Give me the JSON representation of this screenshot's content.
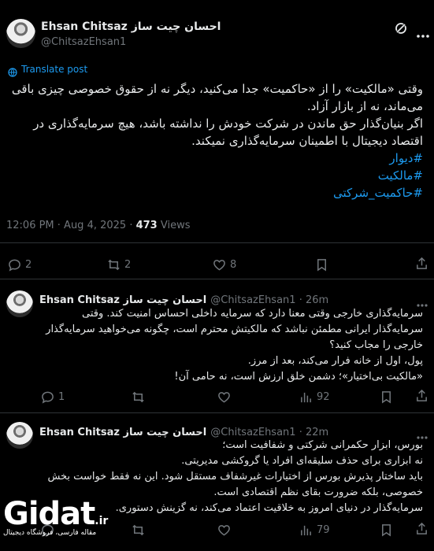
{
  "main_post": {
    "display_name": "Ehsan Chitsaz احسان چیت ساز",
    "handle": "@ChitsazEhsan1",
    "translate_label": "Translate post",
    "text_lines": [
      "وقتی «مالکیت» را از «حاکمیت» جدا می‌کنید، دیگر نه از حقوق خصوصی چیزی باقی",
      "می‌ماند، نه از بازار آزاد.",
      "اگر بنیان‌گذار حق ماندن در شرکت خودش را نداشته باشد، هیچ سرمایه‌گذاری در",
      "اقتصاد دیجیتال با اطمینان سرمایه‌گذاری نمیکند."
    ],
    "hashtags": [
      "#دیوار",
      "#مالکیت",
      "#حاکمیت_شرکتی"
    ],
    "time": "12:06 PM · Aug 4, 2025 · ",
    "views_count": "473",
    "views_label": " Views",
    "replies": "2",
    "reposts": "2",
    "likes": "8"
  },
  "replies": [
    {
      "display_name": "Ehsan Chitsaz احسان چیت ساز",
      "handle": "@ChitsazEhsan1 · 26m",
      "text_lines": [
        "سرمایه‌گذاری خارجی وقتی معنا دارد که سرمایه داخلی احساس امنیت کند. وقتی",
        "سرمایه‌گذار ایرانی مطمئن نباشد که مالکیتش محترم است، چگونه می‌خواهید سرمایه‌گذار",
        "خارجی را مجاب کنید؟",
        "پول، اول از خانه فرار می‌کند، بعد از مرز.",
        "«مالکیت بی‌اختیار»؛ دشمن خلق ارزش است، نه حامی آن!"
      ],
      "replies": "1",
      "views": "92"
    },
    {
      "display_name": "Ehsan Chitsaz احسان چیت ساز",
      "handle": "@ChitsazEhsan1 · 22m",
      "text_lines": [
        "بورس، ابزار حکمرانی شرکتی و شفافیت است؛",
        "نه ابزاری برای حذف سلیقه‌ای افراد یا گروکشی مدیریتی.",
        "باید ساختار پذیرش بورس از اختیارات غیرشفاف مستقل شود. این نه فقط خواست بخش",
        "خصوصی، بلکه ضرورت بقای نظم اقتصادی است.",
        "سرمایه‌گذار در دنیای امروز به خلاقیت اعتماد می‌کند، نه گزینش دستوری."
      ],
      "replies": "",
      "views": "79"
    }
  ],
  "watermark": {
    "logo": "Gidat",
    "suffix": ".ir",
    "tagline": "مقاله فارسی، فروشگاه دیجیتال"
  },
  "colors": {
    "background": "#000000",
    "text": "#e7e9ea",
    "muted": "#71767b",
    "link": "#1d9bf0",
    "divider": "#2f3336"
  },
  "icons": [
    "grok-icon",
    "more-icon",
    "translate-icon",
    "reply-icon",
    "repost-icon",
    "like-icon",
    "views-icon",
    "bookmark-icon",
    "share-icon"
  ]
}
